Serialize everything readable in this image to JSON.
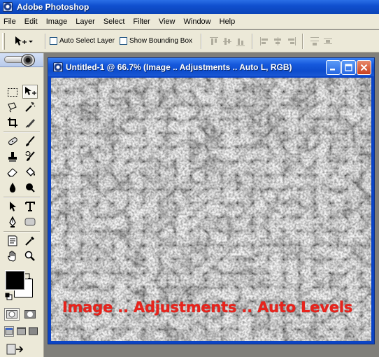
{
  "app": {
    "title": "Adobe Photoshop",
    "icon": "photoshop-logo-icon"
  },
  "menu": [
    "File",
    "Edit",
    "Image",
    "Layer",
    "Select",
    "Filter",
    "View",
    "Window",
    "Help"
  ],
  "options_bar": {
    "tool_icon": "move-tool-icon",
    "auto_select_label": "Auto Select Layer",
    "auto_select_checked": false,
    "bounding_box_label": "Show Bounding Box",
    "bounding_box_checked": false
  },
  "toolbox": {
    "tools": [
      "marquee-tool",
      "move-tool",
      "lasso-tool",
      "magic-wand-tool",
      "crop-tool",
      "slice-tool",
      "healing-brush-tool",
      "brush-tool",
      "clone-stamp-tool",
      "history-brush-tool",
      "eraser-tool",
      "paint-bucket-tool",
      "blur-tool",
      "dodge-tool",
      "path-selection-tool",
      "type-tool",
      "pen-tool",
      "shape-tool",
      "notes-tool",
      "eyedropper-tool",
      "hand-tool",
      "zoom-tool"
    ],
    "active_tool": "move-tool",
    "foreground_color": "#000000",
    "background_color": "#ffffff"
  },
  "document": {
    "title": "Untitled-1 @ 66.7% (Image .. Adjustments .. Auto L, RGB)",
    "zoom": "66.7%",
    "overlay_text": "Image .. Adjustments .. Auto Levels",
    "overlay_color": "#e8231c"
  },
  "colors": {
    "title_bar": "#0b44c5",
    "chrome": "#ece9d8",
    "workspace": "#807f7a"
  }
}
